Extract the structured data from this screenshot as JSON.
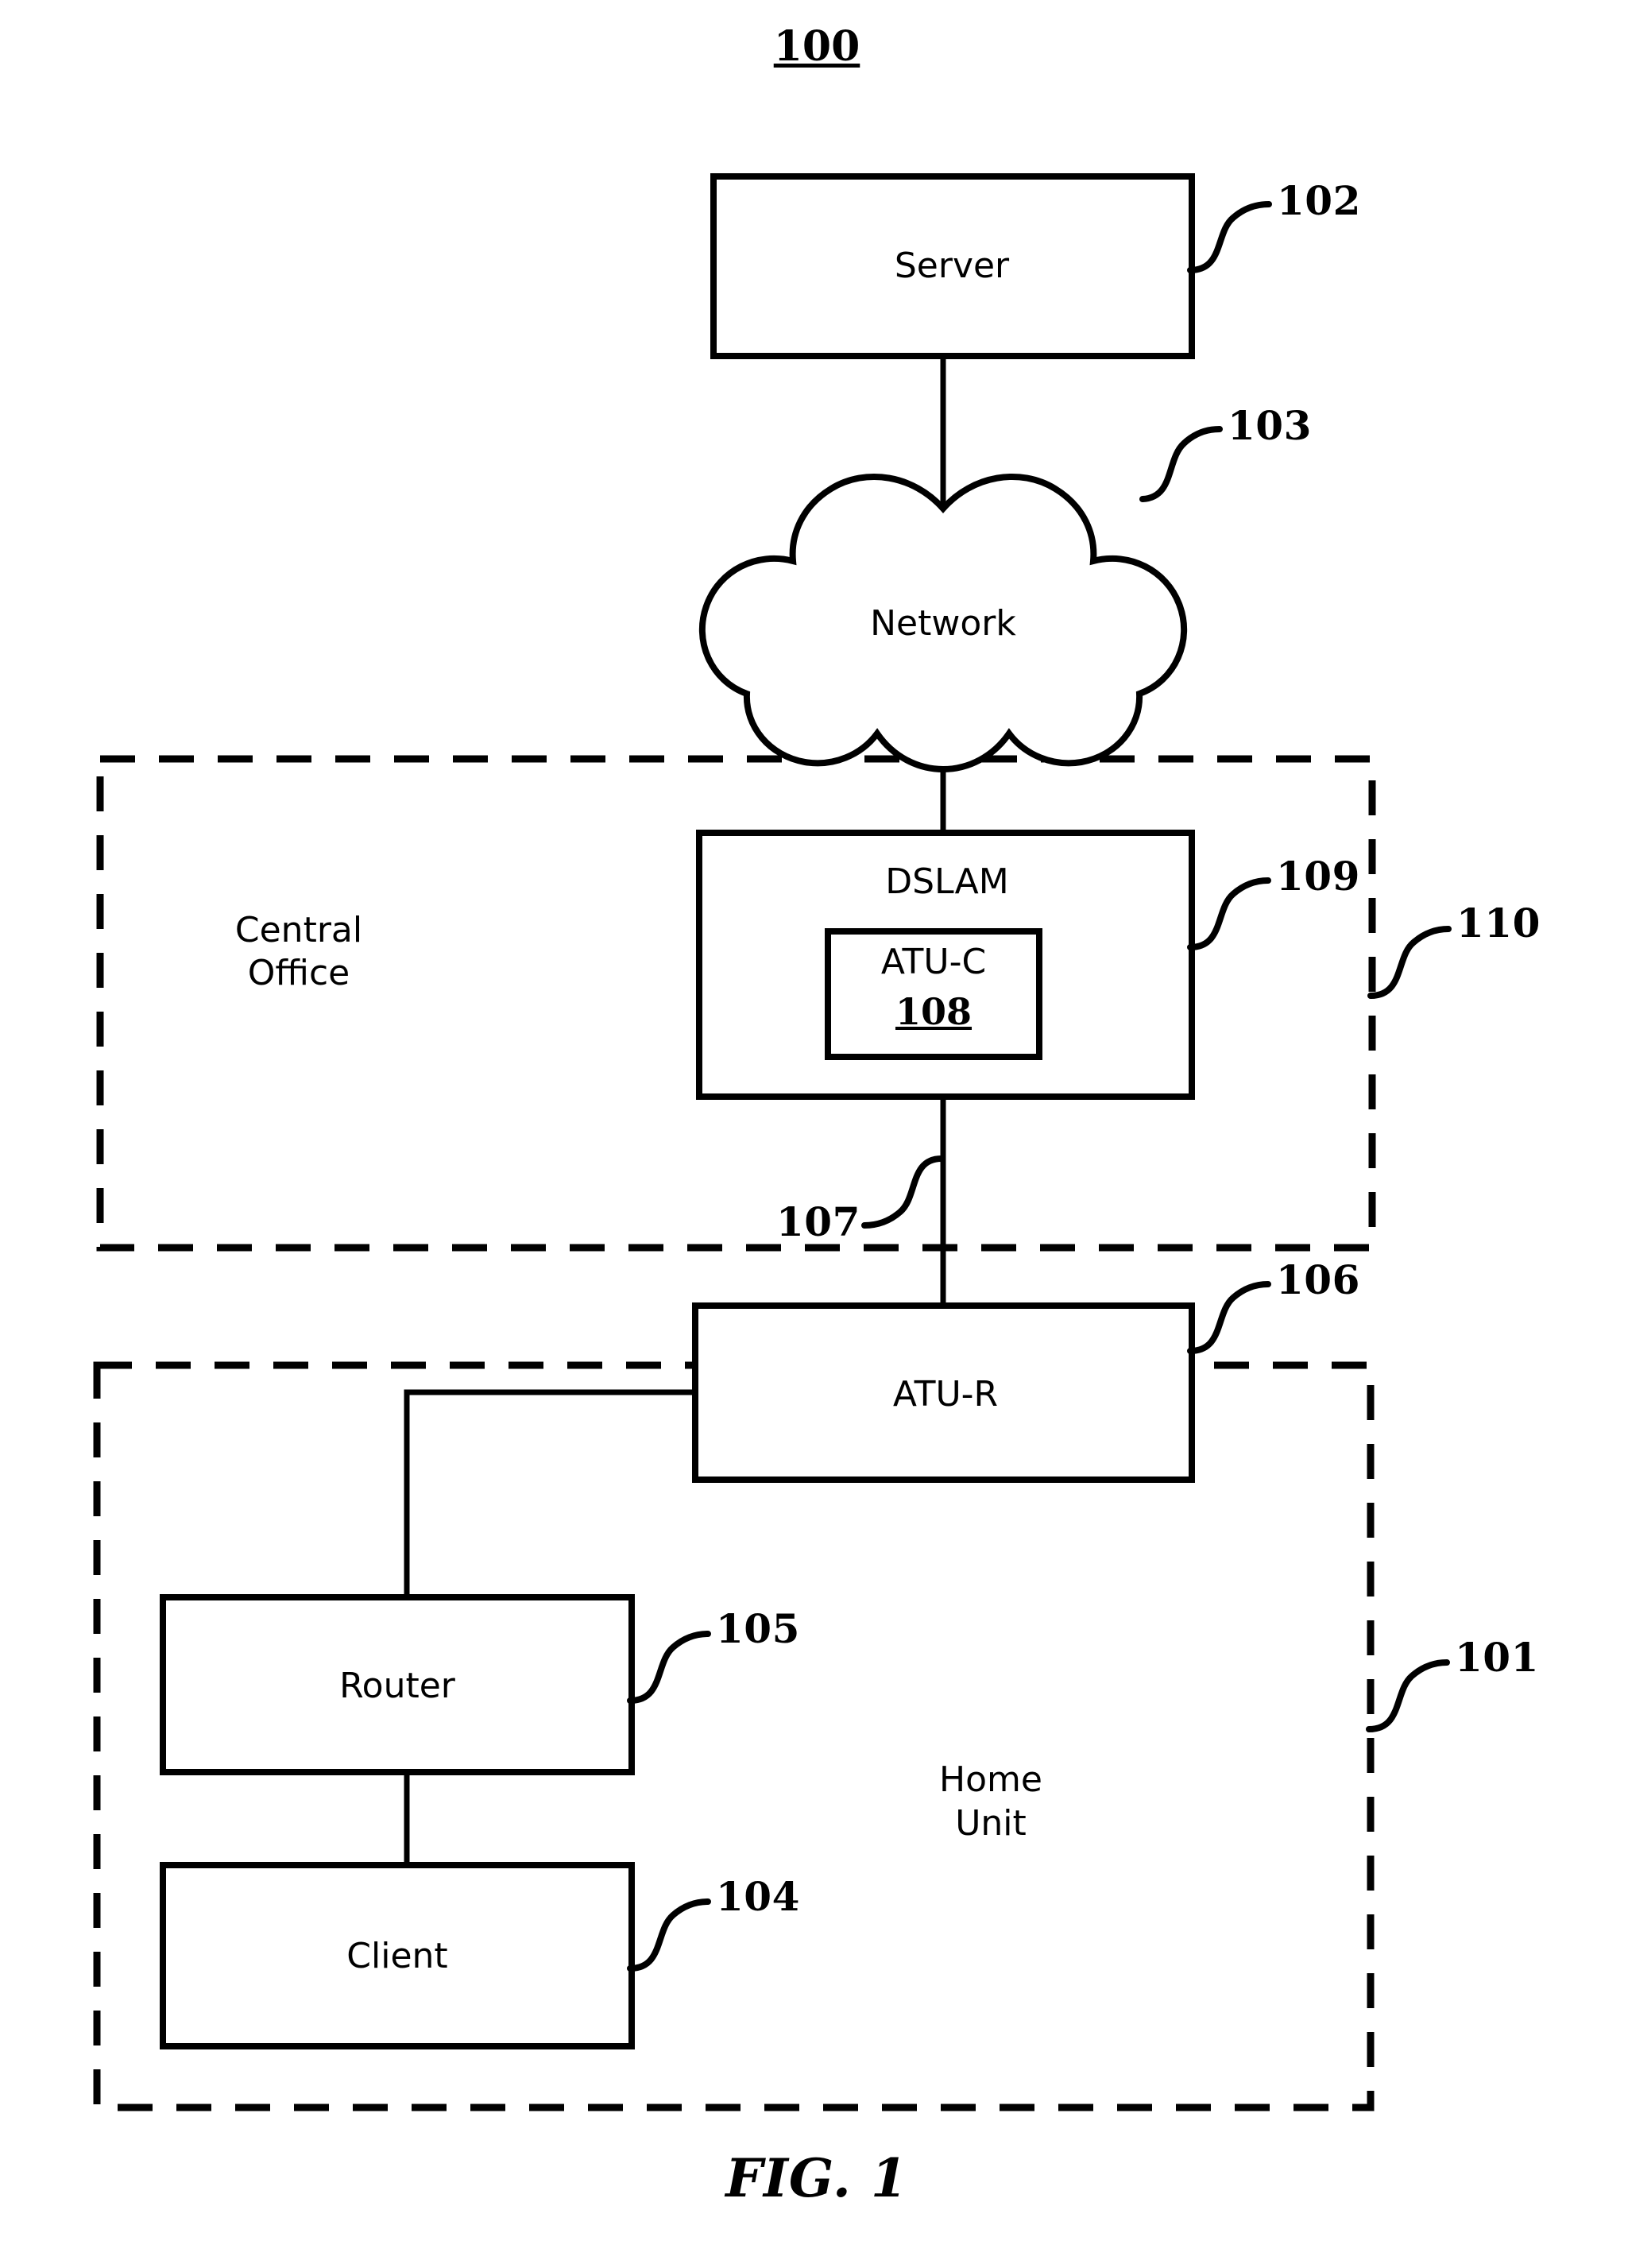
{
  "figure": {
    "title_ref": "100",
    "caption": "FIG. 1",
    "nodes": {
      "server": {
        "label": "Server",
        "ref": "102"
      },
      "network": {
        "label": "Network",
        "ref": "103"
      },
      "dslam": {
        "label": "DSLAM",
        "ref": "109"
      },
      "atu_c": {
        "label": "ATU-C",
        "ref": "108"
      },
      "atu_r": {
        "label": "ATU-R",
        "ref": "106"
      },
      "router": {
        "label": "Router",
        "ref": "105"
      },
      "client": {
        "label": "Client",
        "ref": "104"
      }
    },
    "regions": {
      "central_office": {
        "label_line1": "Central",
        "label_line2": "Office",
        "ref": "110"
      },
      "home_unit": {
        "label_line1": "Home",
        "label_line2": "Unit",
        "ref": "101"
      }
    },
    "links": {
      "dsl_line_ref": "107"
    },
    "colors": {
      "stroke": "#000000",
      "background": "#ffffff"
    }
  }
}
